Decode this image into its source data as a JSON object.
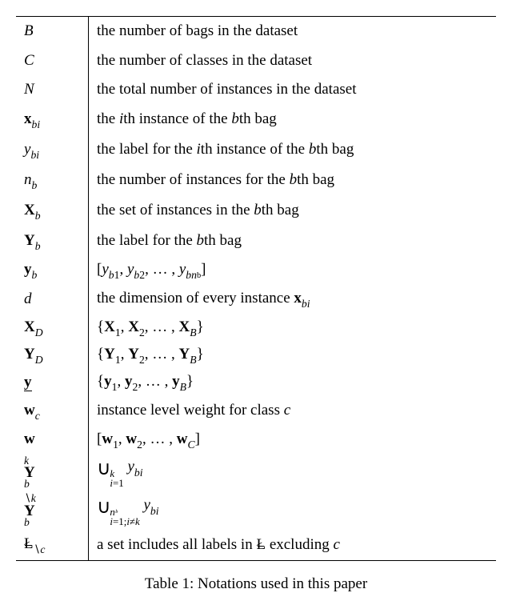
{
  "rows": [
    {
      "sym_html": "<span class='it'>B</span>",
      "desc": "the number of bags in the dataset"
    },
    {
      "sym_html": "<span class='it'>C</span>",
      "desc": "the number of classes in the dataset"
    },
    {
      "sym_html": "<span class='it'>N</span>",
      "desc": "the total number of instances in the dataset"
    },
    {
      "sym_html": "<span class='bf'>x</span><span class='it sub'>bi</span>",
      "desc_html": "the <span class='it'>i</span>th instance of the <span class='it'>b</span>th bag"
    },
    {
      "sym_html": "<span class='it'>y</span><span class='it sub'>bi</span>",
      "desc_html": "the label for the <span class='it'>i</span>th instance of the <span class='it'>b</span>th bag"
    },
    {
      "sym_html": "<span class='it'>n</span><span class='it sub'>b</span>",
      "desc_html": "the number of instances for the <span class='it'>b</span>th bag"
    },
    {
      "sym_html": "<span class='bf'>X</span><span class='it sub'>b</span>",
      "desc_html": "the set of instances in the <span class='it'>b</span>th bag"
    },
    {
      "sym_html": "<span class='bf'>Y</span><span class='it sub'>b</span>",
      "desc_html": "the label for the <span class='it'>b</span>th bag"
    },
    {
      "sym_html": "<span class='bf'>y</span><span class='it sub'>b</span>",
      "desc_html": "[<span class='it'>y</span><span class='sub it'>b</span><span class='sub'>1</span>, <span class='it'>y</span><span class='sub it'>b</span><span class='sub'>2</span>, … , <span class='it'>y</span><span class='sub it'>bn</span><span class='sub' style='font-size:0.55em'>b</span>]"
    },
    {
      "sym_html": "<span class='it'>d</span>",
      "desc_html": "the dimension of every instance <span class='bf'>x</span><span class='it sub'>bi</span>"
    },
    {
      "sym_html": "<span class='bf'>X</span><span class='it sub'>D</span>",
      "desc_html": "{<span class='bf'>X</span><span class='sub'>1</span>, <span class='bf'>X</span><span class='sub'>2</span>, … , <span class='bf'>X</span><span class='it sub'>B</span>}"
    },
    {
      "sym_html": "<span class='bf'>Y</span><span class='it sub'>D</span>",
      "desc_html": "{<span class='bf'>Y</span><span class='sub'>1</span>, <span class='bf'>Y</span><span class='sub'>2</span>, … , <span class='bf'>Y</span><span class='it sub'>B</span>}"
    },
    {
      "sym_html": "<span class='under'><span class='bf'>y</span></span>",
      "desc_html": "{<span class='bf'>y</span><span class='sub'>1</span>, <span class='bf'>y</span><span class='sub'>2</span>, … , <span class='bf'>y</span><span class='it sub'>B</span>}"
    },
    {
      "sym_html": "<span class='bf'>w</span><span class='it sub'>c</span>",
      "desc_html": "instance level weight for class <span class='it'>c</span>"
    },
    {
      "sym_html": "<span class='bf'>w</span>",
      "desc_html": "[<span class='bf'>w</span><span class='sub'>1</span>, <span class='bf'>w</span><span class='sub'>2</span>, … , <span class='bf'>w</span><span class='it sub'>C</span>]"
    },
    {
      "sym_html": "<span class='stacked'><span class='s-sup it'>k</span><span class='s-base'><span class='bf'>Y</span></span><span class='s-sub it'>b</span></span>",
      "desc_html": "<span class='bigcup'>∪</span><span class='supsub'><span class='it'>k</span><span><span class='it'>i</span>=1</span></span> <span class='it'>y</span><span class='it sub'>bi</span>"
    },
    {
      "sym_html": "<span class='stacked'><span class='s-sup'>∖<span class='it'>k</span></span><span class='s-base'><span class='bf'>Y</span></span><span class='s-sub it'>b</span></span>",
      "desc_html": "<span class='bigcup'>∪</span><span class='supsub'><span><span class='it'>n</span><span style='font-size:0.8em' class='it'>ᵇ</span></span><span><span class='it'>i</span>=1;<span class='it'>i</span>≠<span class='it'>k</span></span></span> <span class='it'>y</span><span class='it sub'>bi</span>"
    },
    {
      "sym_html": "<span class='lbar'>Ł</span><span class='sub'>∖<span class='it'>c</span></span>",
      "desc_html": "a set includes all labels in <span class='lbar'>Ł</span> excluding <span class='it'>c</span>"
    }
  ],
  "caption_prefix": "Table 1: Notations used in this paper"
}
